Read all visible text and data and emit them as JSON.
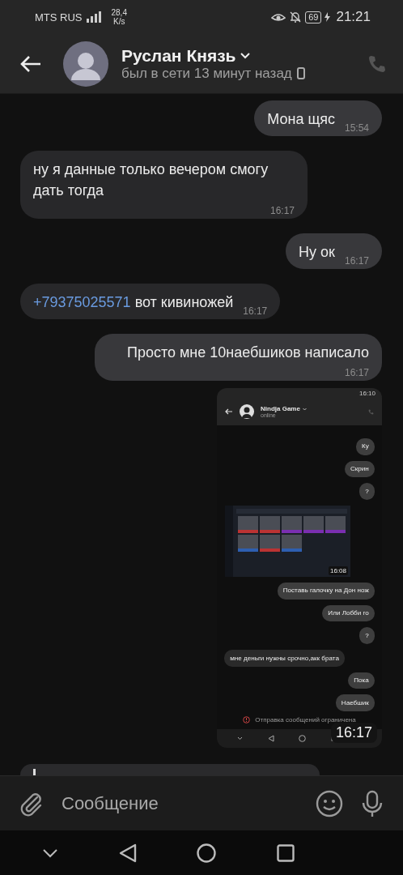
{
  "status_bar": {
    "carrier": "MTS RUS",
    "speed": "28,4",
    "speed_unit": "K/s",
    "battery": "69",
    "time": "21:21"
  },
  "header": {
    "name": "Руслан Князь",
    "presence": "был в сети 13 минут назад"
  },
  "messages": [
    {
      "kind": "text",
      "outgoing": true,
      "text": "Мона щяс",
      "time": "15:54"
    },
    {
      "kind": "text",
      "outgoing": false,
      "text": "ну я данные только вечером смогу дать тогда",
      "time": "16:17"
    },
    {
      "kind": "text",
      "outgoing": true,
      "text": "Ну ок",
      "time": "16:17"
    },
    {
      "kind": "text",
      "outgoing": false,
      "link": "+79375025571",
      "text": "вот кивиножей",
      "time": "16:17"
    },
    {
      "kind": "text",
      "outgoing": true,
      "text": "Просто мне 10наебшиков написало",
      "time": "16:17"
    },
    {
      "kind": "screenshot",
      "outgoing": true,
      "time": "16:17",
      "screenshot": {
        "status_time": "16:10",
        "contact": "Nindja Game",
        "presence": "online",
        "messages": [
          {
            "kind": "text",
            "outgoing": true,
            "text": "Ку"
          },
          {
            "kind": "text",
            "outgoing": true,
            "text": "Скрин"
          },
          {
            "kind": "text",
            "outgoing": true,
            "text": "?"
          },
          {
            "kind": "picture",
            "time": "16:08"
          },
          {
            "kind": "text",
            "outgoing": true,
            "text": "Поставь галочку на Дон нож"
          },
          {
            "kind": "text",
            "outgoing": true,
            "text": "Или Лобби го"
          },
          {
            "kind": "text",
            "outgoing": true,
            "text": "?"
          },
          {
            "kind": "text",
            "outgoing": false,
            "text": "мне деньги нужны срочно,акк брата"
          },
          {
            "kind": "text",
            "outgoing": true,
            "text": "Пока"
          },
          {
            "kind": "text",
            "outgoing": true,
            "text": "Наебшик"
          }
        ],
        "notice": "Отправка сообщений ограничена"
      }
    },
    {
      "kind": "partial"
    }
  ],
  "composer": {
    "placeholder": "Сообщение"
  }
}
